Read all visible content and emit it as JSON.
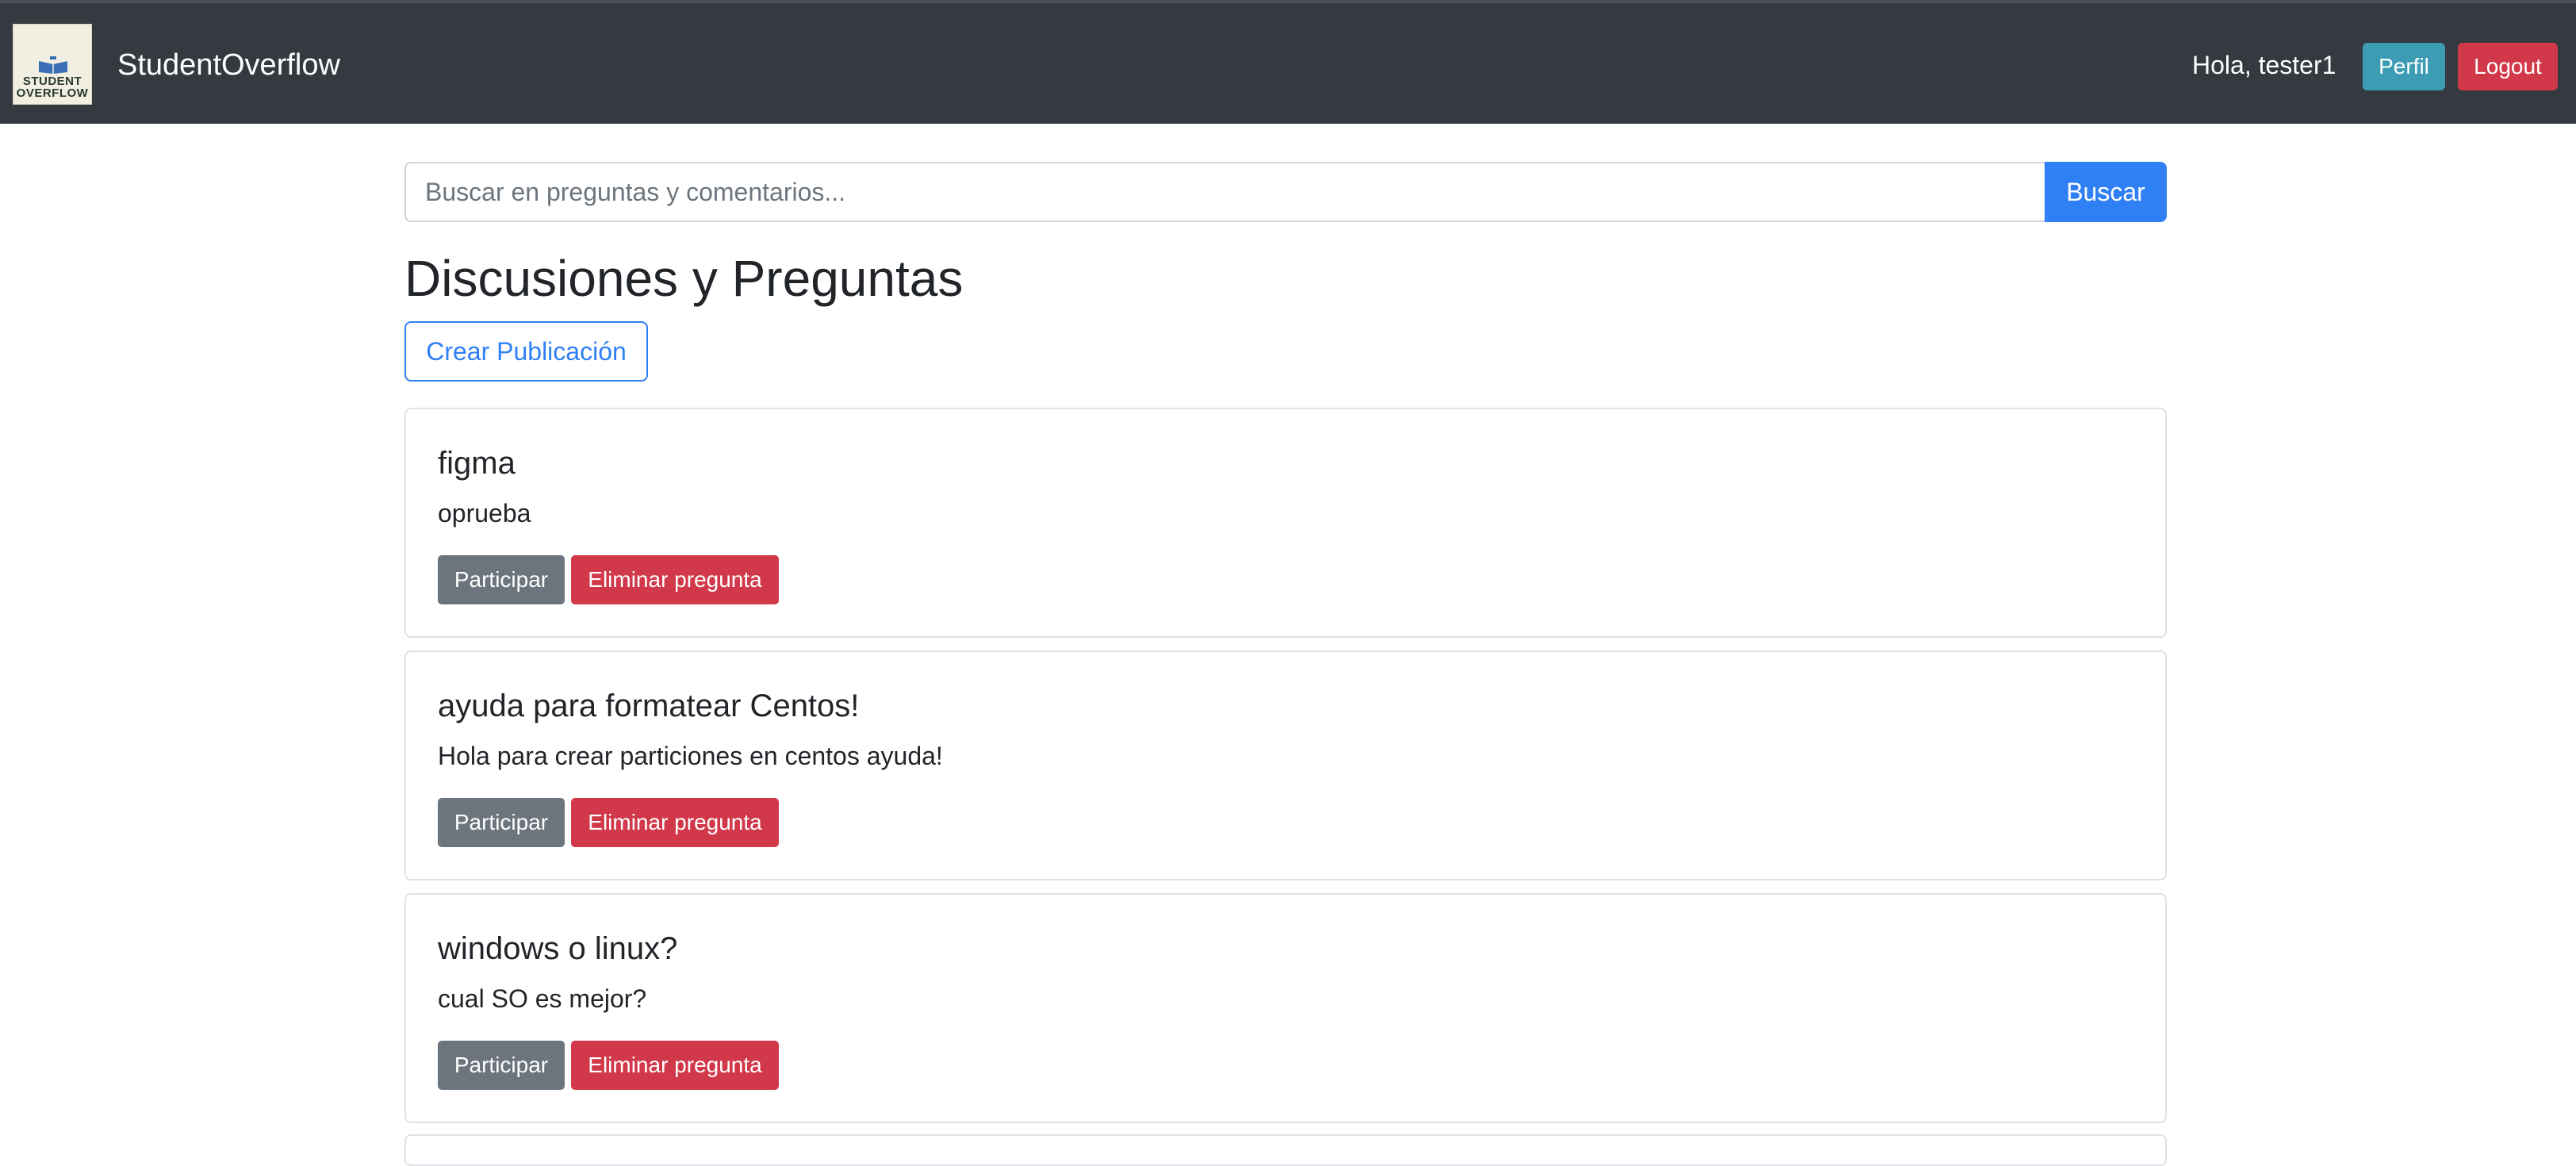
{
  "navbar": {
    "logo_text_line1": "STUDENT",
    "logo_text_line2": "OVERFLOW",
    "brand": "StudentOverflow",
    "greeting": "Hola, tester1",
    "profile_label": "Perfil",
    "logout_label": "Logout"
  },
  "search": {
    "placeholder": "Buscar en preguntas y comentarios...",
    "button_label": "Buscar"
  },
  "page_title": "Discusiones y Preguntas",
  "create_label": "Crear Publicación",
  "posts": [
    {
      "title": "figma",
      "body": "oprueba",
      "join_label": "Participar",
      "delete_label": "Eliminar pregunta"
    },
    {
      "title": "ayuda para formatear Centos!",
      "body": "Hola para crear particiones en centos ayuda!",
      "join_label": "Participar",
      "delete_label": "Eliminar pregunta"
    },
    {
      "title": "windows o linux?",
      "body": "cual SO es mejor?",
      "join_label": "Participar",
      "delete_label": "Eliminar pregunta"
    }
  ],
  "colors": {
    "navbar": "#343a40",
    "primary": "#2f7ff5",
    "info": "#3c9cb3",
    "danger": "#d1394a",
    "secondary": "#6c757d"
  }
}
